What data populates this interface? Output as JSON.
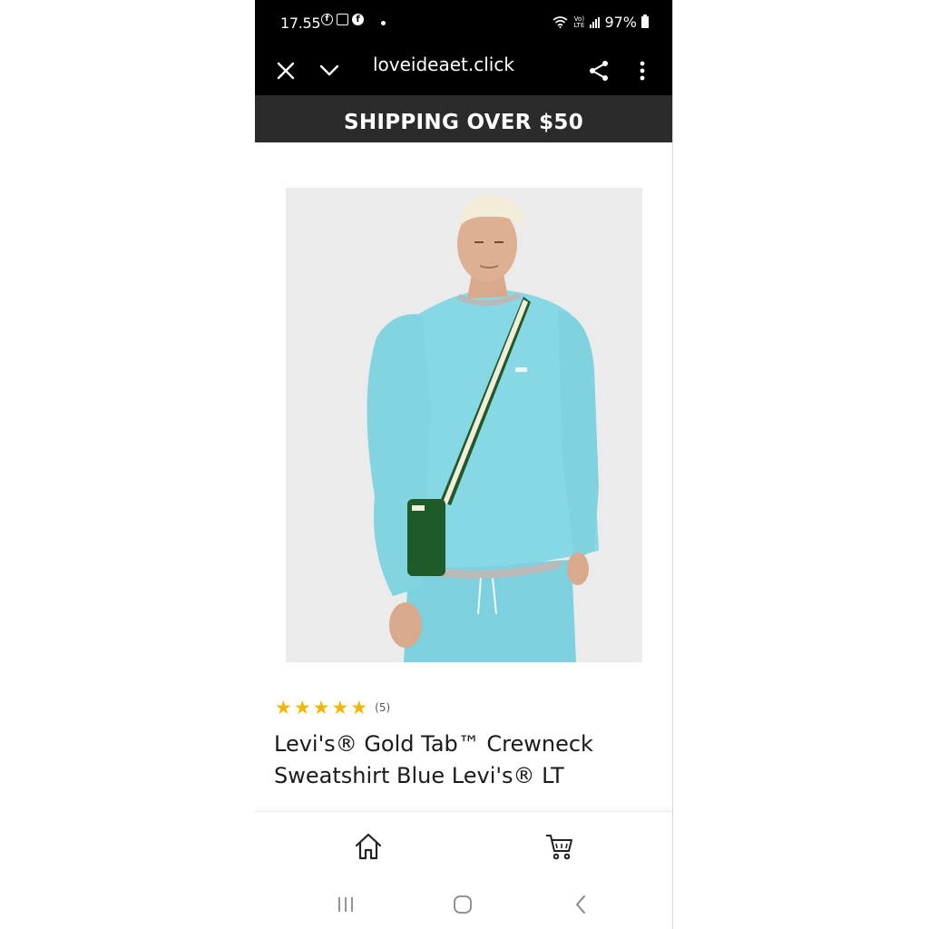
{
  "status_bar": {
    "time": "17.55",
    "network_label": "Vo) LTE",
    "battery": "97%"
  },
  "browser": {
    "url": "loveideaet.click",
    "icons": [
      "close-icon",
      "chevron-down-icon",
      "share-icon",
      "more-vert-icon"
    ]
  },
  "banner": {
    "text": "SHIPPING OVER $50"
  },
  "product": {
    "image_alt_icon": "product-photo",
    "stars": [
      "★",
      "★",
      "★",
      "★",
      "★"
    ],
    "rating_count": "(5)",
    "title": "Levi's® Gold Tab™ Crewneck Sweatshirt Blue Levi's® LT"
  },
  "bottom_nav": {
    "icons": [
      "home-icon",
      "cart-icon"
    ]
  },
  "system_nav": {
    "icons": [
      "recents-icon",
      "home-circle-icon",
      "back-icon"
    ]
  },
  "colors": {
    "star": "#f2b705",
    "banner_bg": "#2b2b2b",
    "sweatshirt": "#7fd3e0",
    "bag": "#1f5a2a"
  }
}
